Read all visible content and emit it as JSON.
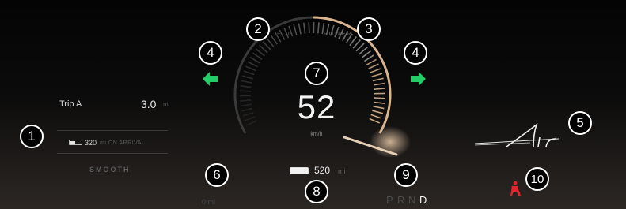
{
  "trip": {
    "label": "Trip A",
    "value": "3.0",
    "unit": "mi"
  },
  "arrival": {
    "value": "320",
    "suffix": "mi ON ARRIVAL",
    "battery_level": 0.4
  },
  "drive_mode": "SMOOTH",
  "odometer": "0 mi",
  "gauge": {
    "left_label": "ECO",
    "right_label": "POWER",
    "speed": "52",
    "speed_unit": "km/h"
  },
  "range": {
    "value": "520",
    "unit": "mi",
    "battery_level": 1.0
  },
  "gear_selector": {
    "gears": [
      "P",
      "R",
      "N",
      "D"
    ],
    "active": "D"
  },
  "logo_text": "Air",
  "callouts": [
    "1",
    "2",
    "3",
    "4",
    "4",
    "5",
    "6",
    "7",
    "8",
    "9",
    "10"
  ],
  "colors": {
    "turn_signal": "#22cc66",
    "power_accent": "#d9b48f",
    "seatbelt_warning": "#e0262a"
  },
  "icons": {
    "left_turn": "left-turn-arrow-icon",
    "right_turn": "right-turn-arrow-icon",
    "seatbelt": "seatbelt-warning-icon",
    "battery": "battery-icon"
  }
}
